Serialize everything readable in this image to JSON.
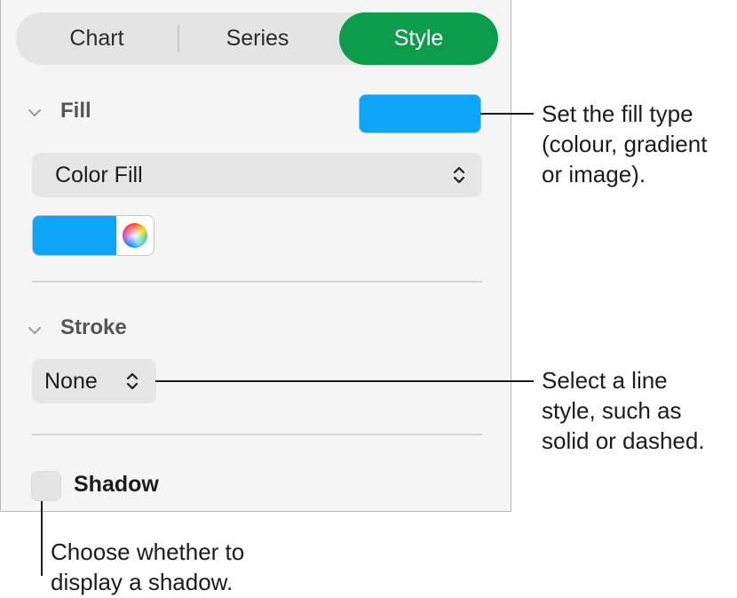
{
  "tabs": [
    {
      "label": "Chart"
    },
    {
      "label": "Series"
    },
    {
      "label": "Style",
      "selected": true
    }
  ],
  "fill": {
    "title": "Fill",
    "swatch_color": "#0ea4f7",
    "type_popup": "Color Fill",
    "well_color": "#0ea4f7"
  },
  "stroke": {
    "title": "Stroke",
    "style_popup": "None"
  },
  "shadow": {
    "label": "Shadow",
    "checked": false
  },
  "callouts": {
    "fill_line1": "Set the fill type",
    "fill_line2": "(colour, gradient",
    "fill_line3": "or image).",
    "stroke_line1": "Select a line",
    "stroke_line2": "style, such as",
    "stroke_line3": "solid or dashed.",
    "shadow_line1": "Choose whether to",
    "shadow_line2": "display a shadow."
  },
  "colors": {
    "accent_green": "#0b9d4b",
    "fill_blue": "#0ea4f7"
  }
}
